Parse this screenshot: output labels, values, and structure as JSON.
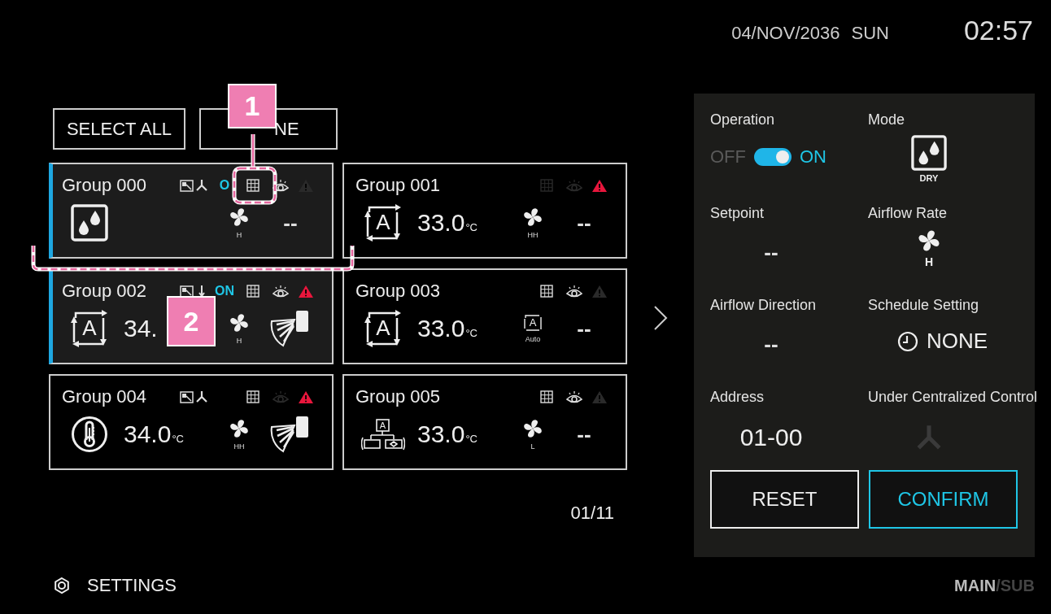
{
  "header": {
    "date": "04/NOV/2036",
    "day": "SUN",
    "time": "02:57"
  },
  "select_buttons": [
    {
      "label": "SELECT ALL",
      "kind": "full"
    },
    {
      "label": "NE",
      "kind": "covered"
    }
  ],
  "cards": [
    {
      "name": "Group 000",
      "selected": true,
      "indicators": [
        {
          "kind": "display",
          "active": true
        },
        {
          "kind": "branch",
          "active": true
        },
        {
          "kind": "on",
          "label": "O",
          "active": true
        },
        {
          "kind": "grid",
          "active": true
        },
        {
          "kind": "eye",
          "active": true
        },
        {
          "kind": "alert",
          "active": false
        }
      ],
      "mode": {
        "kind": "dry"
      },
      "fan": {
        "kind": "fan",
        "label": "H"
      },
      "direction": {
        "kind": "text",
        "value": "--"
      }
    },
    {
      "name": "Group 001",
      "selected": false,
      "indicators": [
        {
          "kind": "grid",
          "active": false
        },
        {
          "kind": "eye",
          "active": false
        },
        {
          "kind": "alert",
          "active": true
        }
      ],
      "mode": {
        "kind": "auto",
        "symbol": "A"
      },
      "temperature": "33.0",
      "unit": "°C",
      "fan": {
        "kind": "fan",
        "label": "HH"
      },
      "direction": {
        "kind": "text",
        "value": "--"
      }
    },
    {
      "name": "Group 002",
      "selected": true,
      "indicators": [
        {
          "kind": "display",
          "active": true
        },
        {
          "kind": "thermo",
          "active": true
        },
        {
          "kind": "on",
          "label": "ON",
          "active": true
        },
        {
          "kind": "grid",
          "active": true
        },
        {
          "kind": "eye",
          "active": true
        },
        {
          "kind": "alert",
          "active": true
        }
      ],
      "mode": {
        "kind": "auto",
        "symbol": "A"
      },
      "temperature": "34.",
      "fan": {
        "kind": "fan",
        "label": "H"
      },
      "direction": {
        "kind": "louver"
      }
    },
    {
      "name": "Group 003",
      "selected": false,
      "indicators": [
        {
          "kind": "grid",
          "active": true
        },
        {
          "kind": "eye",
          "active": true
        },
        {
          "kind": "alert",
          "active": false
        }
      ],
      "mode": {
        "kind": "auto",
        "symbol": "A"
      },
      "temperature": "33.0",
      "unit": "°C",
      "fan": {
        "kind": "auto",
        "symbol": "A",
        "label": "Auto"
      },
      "direction": {
        "kind": "text",
        "value": "--"
      }
    },
    {
      "name": "Group 004",
      "selected": false,
      "indicators": [
        {
          "kind": "display",
          "active": true
        },
        {
          "kind": "branch",
          "active": true
        },
        {
          "kind": "grid",
          "active": true
        },
        {
          "kind": "eye",
          "active": false
        },
        {
          "kind": "alert",
          "active": true
        }
      ],
      "mode": {
        "kind": "heat"
      },
      "temperature": "34.0",
      "unit": "°C",
      "fan": {
        "kind": "fan",
        "label": "HH"
      },
      "direction": {
        "kind": "louver"
      }
    },
    {
      "name": "Group 005",
      "selected": false,
      "indicators": [
        {
          "kind": "grid",
          "active": true
        },
        {
          "kind": "eye",
          "active": true
        },
        {
          "kind": "alert",
          "active": false
        }
      ],
      "mode": {
        "kind": "combo",
        "symbol": "A"
      },
      "temperature": "33.0",
      "unit": "°C",
      "fan": {
        "kind": "fan",
        "label": "L"
      },
      "direction": {
        "kind": "text",
        "value": "--"
      }
    }
  ],
  "page": "01/11",
  "panel": {
    "operation": {
      "title": "Operation",
      "off_label": "OFF",
      "on_label": "ON",
      "on": true
    },
    "mode": {
      "title": "Mode",
      "kind": "dry",
      "label": "DRY"
    },
    "setpoint": {
      "title": "Setpoint",
      "value": "--"
    },
    "airflow_rate": {
      "title": "Airflow Rate",
      "label": "H"
    },
    "airflow_direction": {
      "title": "Airflow Direction",
      "value": "--"
    },
    "schedule": {
      "title": "Schedule Setting",
      "value": "NONE"
    },
    "address": {
      "title": "Address",
      "value": "01-00"
    },
    "centralized": {
      "title": "Under Centralized Control",
      "active": false
    },
    "buttons": [
      {
        "label": "RESET",
        "kind": "plain"
      },
      {
        "label": "CONFIRM",
        "kind": "primary"
      }
    ]
  },
  "footer": {
    "settings": "SETTINGS",
    "views": [
      {
        "label": "MAIN",
        "selected": true
      },
      {
        "label": "SUB",
        "selected": false
      }
    ],
    "separator": "/"
  },
  "annotations": [
    {
      "label": "1"
    },
    {
      "label": "2"
    }
  ]
}
